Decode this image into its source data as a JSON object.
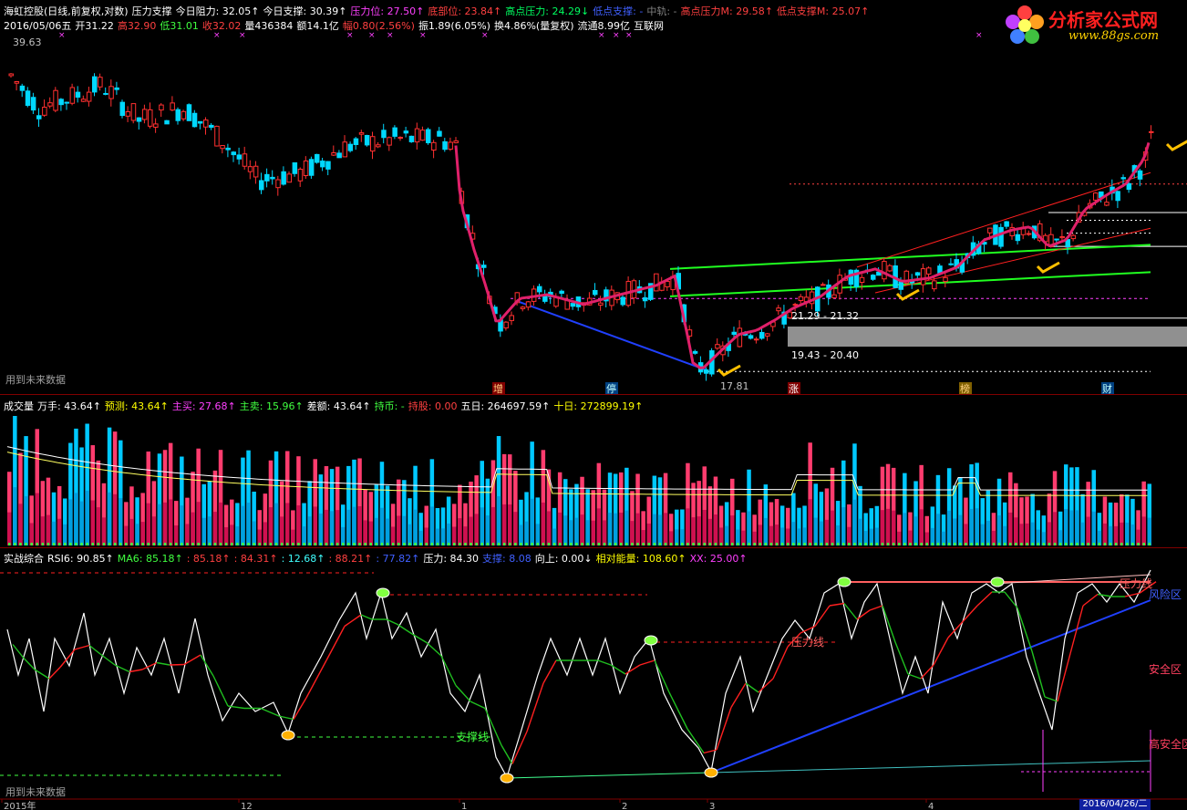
{
  "header": {
    "line1": [
      {
        "t": "海虹控股(日线,前复权,对数)",
        "c": "#ffffff"
      },
      {
        "t": "压力支撑",
        "c": "#ffffff"
      },
      {
        "t": "今日阻力: 32.05↑",
        "c": "#ffffff"
      },
      {
        "t": "今日支撑: 30.39↑",
        "c": "#ffffff"
      },
      {
        "t": "压力位: 27.50↑",
        "c": "#ff40ff"
      },
      {
        "t": "底部位: 23.84↑",
        "c": "#ff4040"
      },
      {
        "t": "高点压力: 24.29↓",
        "c": "#00ff60"
      },
      {
        "t": "低点支撑: -",
        "c": "#4060ff"
      },
      {
        "t": "中轨: -",
        "c": "#808080"
      },
      {
        "t": "高点压力M: 29.58↑",
        "c": "#ff4040"
      },
      {
        "t": "低点支撑M: 25.07↑",
        "c": "#ff4040"
      }
    ],
    "line2": [
      {
        "t": "2016/05/06五",
        "c": "#ffffff"
      },
      {
        "t": "开31.22",
        "c": "#ffffff"
      },
      {
        "t": "高32.90",
        "c": "#ff4040"
      },
      {
        "t": "低31.01",
        "c": "#40ff40"
      },
      {
        "t": "收32.02",
        "c": "#ff4040"
      },
      {
        "t": "量436384",
        "c": "#ffffff"
      },
      {
        "t": "额14.1亿",
        "c": "#ffffff"
      },
      {
        "t": "幅0.80(2.56%)",
        "c": "#ff4040"
      },
      {
        "t": "振1.89(6.05%)",
        "c": "#ffffff"
      },
      {
        "t": "换4.86%(量复权)",
        "c": "#ffffff"
      },
      {
        "t": "流通8.99亿",
        "c": "#ffffff"
      },
      {
        "t": "互联网",
        "c": "#ffffff"
      }
    ]
  },
  "logo": {
    "name": "分析家公式网",
    "url": "www.88gs.com"
  },
  "price_panel": {
    "top_price_label": "39.63",
    "low_price_label": "17.81",
    "range_label_1": "21.29 - 21.32",
    "range_label_2": "19.43 - 20.40",
    "future_note": "用到未来数据",
    "signals": [
      {
        "t": "增",
        "bg": "#800000",
        "c": "#ffd080"
      },
      {
        "t": "停",
        "bg": "#004080",
        "c": "#c0ffff"
      },
      {
        "t": "涨",
        "bg": "#800000",
        "c": "#ffffff"
      },
      {
        "t": "榜",
        "bg": "#806000",
        "c": "#ffd080"
      },
      {
        "t": "财",
        "bg": "#004080",
        "c": "#c0ffff"
      }
    ]
  },
  "volume_panel": {
    "items": [
      {
        "t": "成交量",
        "c": "#ffffff"
      },
      {
        "t": "万手: 43.64↑",
        "c": "#ffffff"
      },
      {
        "t": "预测: 43.64↑",
        "c": "#ffff00"
      },
      {
        "t": "主买: 27.68↑",
        "c": "#ff40ff"
      },
      {
        "t": "主卖: 15.96↑",
        "c": "#40ff40"
      },
      {
        "t": "差额: 43.64↑",
        "c": "#ffffff"
      },
      {
        "t": "持币: -",
        "c": "#40ff40"
      },
      {
        "t": "持股: 0.00",
        "c": "#ff4040"
      },
      {
        "t": "五日: 264697.59↑",
        "c": "#ffffff"
      },
      {
        "t": "十日: 272899.19↑",
        "c": "#ffff00"
      }
    ]
  },
  "rsi_panel": {
    "items": [
      {
        "t": "实战综合",
        "c": "#ffffff"
      },
      {
        "t": "RSI6: 90.85↑",
        "c": "#ffffff"
      },
      {
        "t": "MA6: 85.18↑",
        "c": "#40ff40"
      },
      {
        "t": ": 85.18↑",
        "c": "#ff4040"
      },
      {
        "t": ": 84.31↑",
        "c": "#ff4040"
      },
      {
        "t": ": 12.68↑",
        "c": "#40ffff"
      },
      {
        "t": ": 88.21↑",
        "c": "#ff4040"
      },
      {
        "t": ": 77.82↑",
        "c": "#4060ff"
      },
      {
        "t": "压力: 84.30",
        "c": "#ffffff"
      },
      {
        "t": "支撑: 8.08",
        "c": "#4060ff"
      },
      {
        "t": "向上: 0.00↓",
        "c": "#ffffff"
      },
      {
        "t": "相对能量: 108.60↑",
        "c": "#ffff00"
      },
      {
        "t": "XX: 25.00↑",
        "c": "#ff40ff"
      }
    ],
    "labels": {
      "pressure_line": "压力线",
      "support_line": "支撑线",
      "risk_zone": "风险区",
      "safe_zone": "安全区",
      "high_safe": "高安全区",
      "pressure_line_2": "压力线"
    },
    "future_note": "用到未来数据"
  },
  "x_axis": {
    "labels": [
      "2015年",
      "12",
      "1",
      "2",
      "3",
      "4"
    ],
    "current_date": "2016/04/26/二"
  },
  "chart_data": [
    {
      "type": "candlestick",
      "scale": "log",
      "markers": {
        "high": 39.63,
        "low": 17.81
      },
      "support_ranges": [
        [
          21.29,
          21.32
        ],
        [
          19.43,
          20.4
        ]
      ],
      "last_bar": {
        "date": "2016/05/06",
        "open": 31.22,
        "high": 32.9,
        "low": 31.01,
        "close": 32.02
      },
      "levels": {
        "today_resistance": 32.05,
        "today_support": 30.39,
        "pressure": 27.5,
        "bottom": 23.84,
        "high_point_pressure": 24.29,
        "high_point_pressure_m": 29.58,
        "low_point_support_m": 25.07
      }
    },
    {
      "type": "bar",
      "name": "volume",
      "values_last": {
        "wanshou": 43.64,
        "ma5": 264697.59,
        "ma10": 272899.19
      }
    },
    {
      "type": "line",
      "name": "RSI6",
      "last": {
        "RSI6": 90.85,
        "MA6": 85.18
      }
    }
  ]
}
